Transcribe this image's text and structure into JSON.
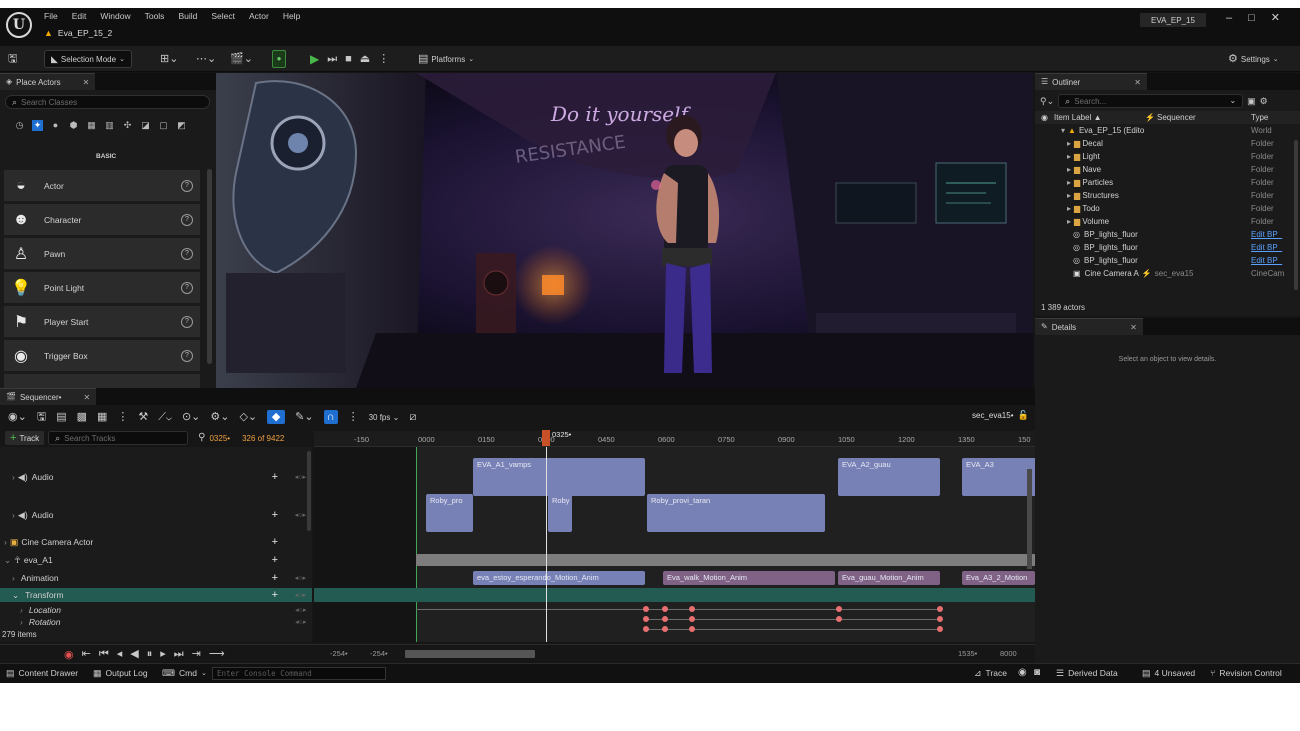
{
  "window": {
    "title": "EVA_EP_15",
    "project_tab": "Eva_EP_15_2"
  },
  "menu": [
    "File",
    "Edit",
    "Window",
    "Tools",
    "Build",
    "Select",
    "Actor",
    "Help"
  ],
  "toolbar": {
    "mode": "Selection Mode",
    "platforms": "Platforms",
    "settings": "Settings"
  },
  "place_actors": {
    "tab": "Place Actors",
    "search_placeholder": "Search Classes",
    "category": "BASIC",
    "items": [
      {
        "label": "Actor",
        "icon": "sphere-icon"
      },
      {
        "label": "Character",
        "icon": "character-icon"
      },
      {
        "label": "Pawn",
        "icon": "pawn-icon"
      },
      {
        "label": "Point Light",
        "icon": "lightbulb-icon"
      },
      {
        "label": "Player Start",
        "icon": "flag-icon"
      },
      {
        "label": "Trigger Box",
        "icon": "box-icon"
      }
    ]
  },
  "sequencer": {
    "tab": "Sequencer•",
    "track_button": "Track",
    "search_placeholder": "Search Tracks",
    "current_frame": "0325•",
    "frame_count": "326 of 9422",
    "fps": "30 fps",
    "sequence_name": "sec_eva15•",
    "items_count": "279 items",
    "playhead_label": "0325•",
    "ruler_ticks": [
      "-150",
      "0000",
      "0150",
      "0300",
      "0450",
      "0600",
      "0750",
      "0900",
      "1050",
      "1200",
      "1350",
      "150"
    ],
    "tracks": [
      {
        "label": "Audio",
        "icon": "speaker-icon"
      },
      {
        "label": "Audio",
        "icon": "speaker-icon"
      },
      {
        "label": "Cine Camera Actor",
        "icon": "camera-icon"
      },
      {
        "label": "eva_A1",
        "icon": "skeleton-icon"
      },
      {
        "label": "Animation"
      },
      {
        "label": "Transform"
      },
      {
        "label": "Location"
      },
      {
        "label": "Rotation"
      }
    ],
    "audio_clips_1": [
      "EVA_A1_vamps",
      "EVA_A2_guau",
      "EVA_A3"
    ],
    "audio_clips_2": [
      "Roby_pro",
      "Roby",
      "Roby_provi_taran"
    ],
    "anim_clips": [
      "eva_estoy_esperando_Motion_Anim",
      "Eva_walk_Motion_Anim",
      "Eva_guau_Motion_Anim",
      "Eva_A3_2_Motion"
    ],
    "bottom_range": [
      "-254•",
      "-254•",
      "1535•",
      "8000"
    ]
  },
  "outliner": {
    "tab": "Outliner",
    "search_placeholder": "Search...",
    "headers": {
      "label": "Item Label ▲",
      "sequencer": "Sequencer",
      "type": "Type"
    },
    "rows": [
      {
        "label": "Eva_EP_15 (Edito",
        "type": "World",
        "kind": "world"
      },
      {
        "label": "Decal",
        "type": "Folder",
        "kind": "folder"
      },
      {
        "label": "Light",
        "type": "Folder",
        "kind": "folder"
      },
      {
        "label": "Nave",
        "type": "Folder",
        "kind": "folder"
      },
      {
        "label": "Particles",
        "type": "Folder",
        "kind": "folder"
      },
      {
        "label": "Structures",
        "type": "Folder",
        "kind": "folder"
      },
      {
        "label": "Todo",
        "type": "Folder",
        "kind": "folder"
      },
      {
        "label": "Volume",
        "type": "Folder",
        "kind": "folder"
      },
      {
        "label": "BP_lights_fluor",
        "type": "Edit BP_",
        "kind": "bp"
      },
      {
        "label": "BP_lights_fluor",
        "type": "Edit BP_",
        "kind": "bp"
      },
      {
        "label": "BP_lights_fluor",
        "type": "Edit BP_",
        "kind": "bp"
      },
      {
        "label": "Cine Camera A",
        "sequencer": "sec_eva15",
        "type": "CineCam",
        "kind": "camera"
      }
    ],
    "actors_count": "1 389 actors"
  },
  "details": {
    "tab": "Details",
    "empty_text": "Select an object to view details."
  },
  "statusbar": {
    "content_drawer": "Content Drawer",
    "output_log": "Output Log",
    "cmd": "Cmd",
    "console_placeholder": "Enter Console Command",
    "trace": "Trace",
    "derived_data": "Derived Data",
    "unsaved": "4 Unsaved",
    "revision_control": "Revision Control"
  },
  "scene": {
    "wall_text_1": "Do it yourself",
    "wall_text_2": "RESISTANCE"
  }
}
